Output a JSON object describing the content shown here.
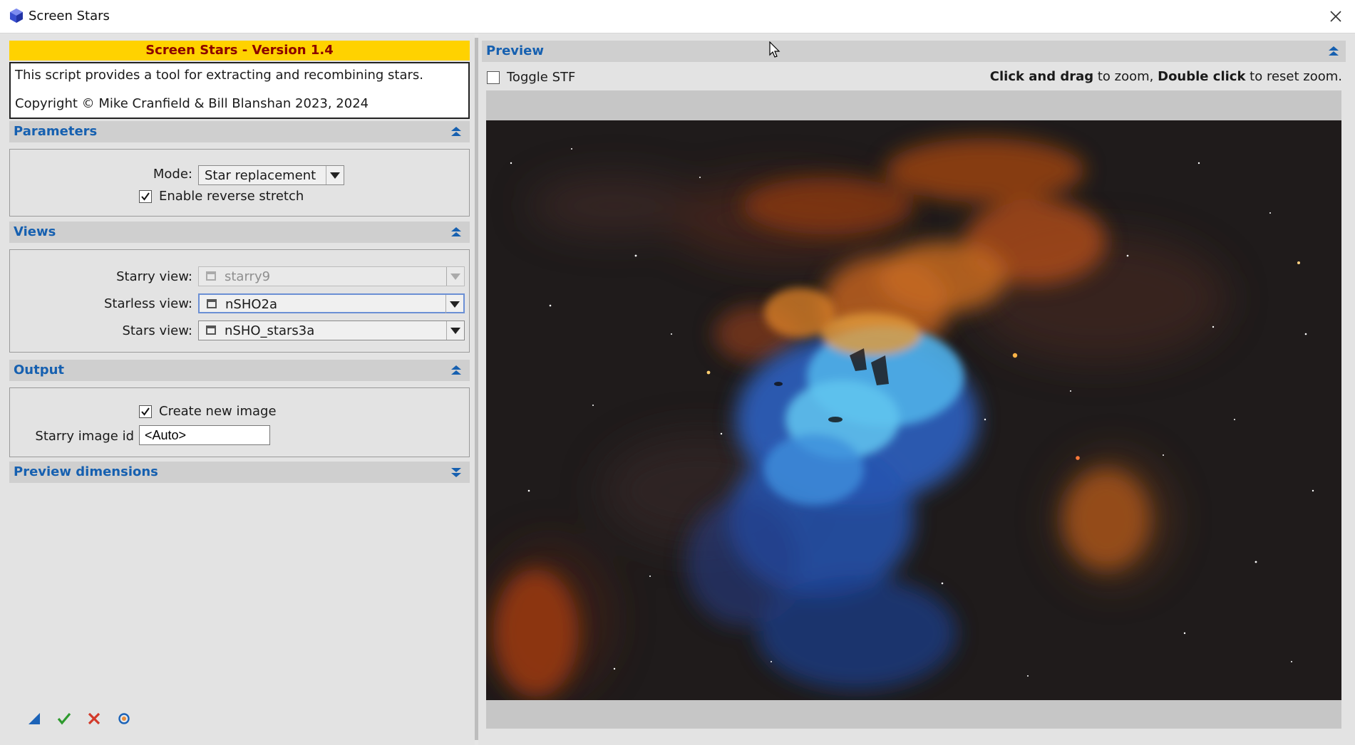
{
  "window": {
    "title": "Screen Stars",
    "app_icon": "pixinsight-cube-icon",
    "close_icon": "close-icon"
  },
  "header": {
    "version_banner": "Screen Stars - Version 1.4",
    "description": "This script provides a tool for extracting and recombining stars.",
    "copyright": "Copyright © Mike Cranfield & Bill Blanshan 2023, 2024"
  },
  "sections": {
    "parameters": "Parameters",
    "views": "Views",
    "output": "Output",
    "preview_dimensions": "Preview dimensions"
  },
  "parameters": {
    "mode_label": "Mode:",
    "mode_value": "Star replacement",
    "reverse_stretch_label": "Enable reverse stretch",
    "reverse_stretch_checked": true
  },
  "views": {
    "starry_label": "Starry view:",
    "starry_value": "starry9",
    "starless_label": "Starless view:",
    "starless_value": "nSHO2a",
    "stars_label": "Stars view:",
    "stars_value": "nSHO_stars3a"
  },
  "output": {
    "create_new_label": "Create new image",
    "create_new_checked": true,
    "starry_id_label": "Starry image id",
    "starry_id_value": "<Auto>"
  },
  "preview": {
    "title": "Preview",
    "toggle_stf_label": "Toggle STF",
    "toggle_stf_checked": false,
    "hint_bold1": "Click and drag",
    "hint_text1": " to zoom, ",
    "hint_bold2": "Double click",
    "hint_text2": " to reset zoom."
  },
  "bottom_bar": {
    "icons": [
      "new-instance-icon",
      "apply-icon",
      "cancel-icon",
      "reset-icon"
    ]
  },
  "colors": {
    "banner_bg": "#ffd200",
    "banner_text": "#8b0000",
    "section_text": "#1660b0",
    "section_bg": "#cfcfcf"
  }
}
